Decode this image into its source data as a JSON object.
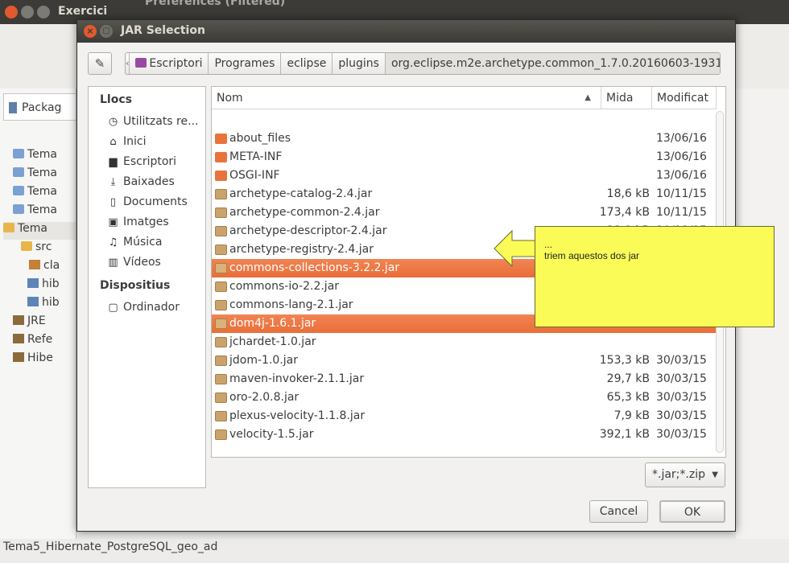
{
  "background": {
    "window_title": "Exercici",
    "preferences_title": "Preferences (Filtered)",
    "package_tab": "Packag",
    "tree": [
      "Tema",
      "Tema",
      "Tema",
      "Tema",
      "Tema",
      "src",
      "cla",
      "hib",
      "hib",
      "JRE",
      "Refe",
      "Hibe"
    ],
    "status_text": "Tema5_Hibernate_PostgreSQL_geo_ad"
  },
  "dialog": {
    "title": "JAR Selection",
    "path_segments": [
      "Escriptori",
      "Programes",
      "eclipse",
      "plugins",
      "org.eclipse.m2e.archetype.common_1.7.0.20160603-1931"
    ],
    "places": {
      "header_places": "Llocs",
      "places": [
        {
          "icon": "clock-icon",
          "glyph": "◷",
          "label": "Utilitzats re..."
        },
        {
          "icon": "home-icon",
          "glyph": "⌂",
          "label": "Inici"
        },
        {
          "icon": "desktop-icon",
          "glyph": "▆",
          "label": "Escriptori"
        },
        {
          "icon": "download-icon",
          "glyph": "⤓",
          "label": "Baixades"
        },
        {
          "icon": "document-icon",
          "glyph": "▯",
          "label": "Documents"
        },
        {
          "icon": "image-icon",
          "glyph": "▣",
          "label": "Imatges"
        },
        {
          "icon": "music-icon",
          "glyph": "♫",
          "label": "Música"
        },
        {
          "icon": "video-icon",
          "glyph": "▥",
          "label": "Vídeos"
        }
      ],
      "header_devices": "Dispositius",
      "devices": [
        {
          "icon": "computer-icon",
          "glyph": "▢",
          "label": "Ordinador"
        }
      ]
    },
    "columns": {
      "name": "Nom",
      "size": "Mida",
      "modified": "Modificat"
    },
    "files": [
      {
        "name": "about_files",
        "type": "folder",
        "size": "",
        "modified": "13/06/16",
        "selected": false
      },
      {
        "name": "META-INF",
        "type": "folder",
        "size": "",
        "modified": "13/06/16",
        "selected": false
      },
      {
        "name": "OSGI-INF",
        "type": "folder",
        "size": "",
        "modified": "13/06/16",
        "selected": false
      },
      {
        "name": "archetype-catalog-2.4.jar",
        "type": "jar",
        "size": "18,6 kB",
        "modified": "10/11/15",
        "selected": false
      },
      {
        "name": "archetype-common-2.4.jar",
        "type": "jar",
        "size": "173,4 kB",
        "modified": "10/11/15",
        "selected": false
      },
      {
        "name": "archetype-descriptor-2.4.jar",
        "type": "jar",
        "size": "23,1 kB",
        "modified": "10/11/15",
        "selected": false
      },
      {
        "name": "archetype-registry-2.4.jar",
        "type": "jar",
        "size": "",
        "modified": "",
        "selected": false
      },
      {
        "name": "commons-collections-3.2.2.jar",
        "type": "jar",
        "size": "",
        "modified": "",
        "selected": true
      },
      {
        "name": "commons-io-2.2.jar",
        "type": "jar",
        "size": "",
        "modified": "",
        "selected": false
      },
      {
        "name": "commons-lang-2.1.jar",
        "type": "jar",
        "size": "",
        "modified": "",
        "selected": false
      },
      {
        "name": "dom4j-1.6.1.jar",
        "type": "jar",
        "size": "",
        "modified": "",
        "selected": true
      },
      {
        "name": "jchardet-1.0.jar",
        "type": "jar",
        "size": "",
        "modified": "",
        "selected": false
      },
      {
        "name": "jdom-1.0.jar",
        "type": "jar",
        "size": "153,3 kB",
        "modified": "30/03/15",
        "selected": false
      },
      {
        "name": "maven-invoker-2.1.1.jar",
        "type": "jar",
        "size": "29,7 kB",
        "modified": "30/03/15",
        "selected": false
      },
      {
        "name": "oro-2.0.8.jar",
        "type": "jar",
        "size": "65,3 kB",
        "modified": "30/03/15",
        "selected": false
      },
      {
        "name": "plexus-velocity-1.1.8.jar",
        "type": "jar",
        "size": "7,9 kB",
        "modified": "30/03/15",
        "selected": false
      },
      {
        "name": "velocity-1.5.jar",
        "type": "jar",
        "size": "392,1 kB",
        "modified": "30/03/15",
        "selected": false
      }
    ],
    "filter": "*.jar;*.zip",
    "cancel_label": "Cancel",
    "ok_label": "OK"
  },
  "callout": {
    "dots": "...",
    "text": "triem aquestos dos jar",
    "fill_color": "#fbfb58"
  },
  "colors": {
    "selection": "#e96e38",
    "folder": "#e8743b",
    "close_button": "#e05a2e"
  }
}
